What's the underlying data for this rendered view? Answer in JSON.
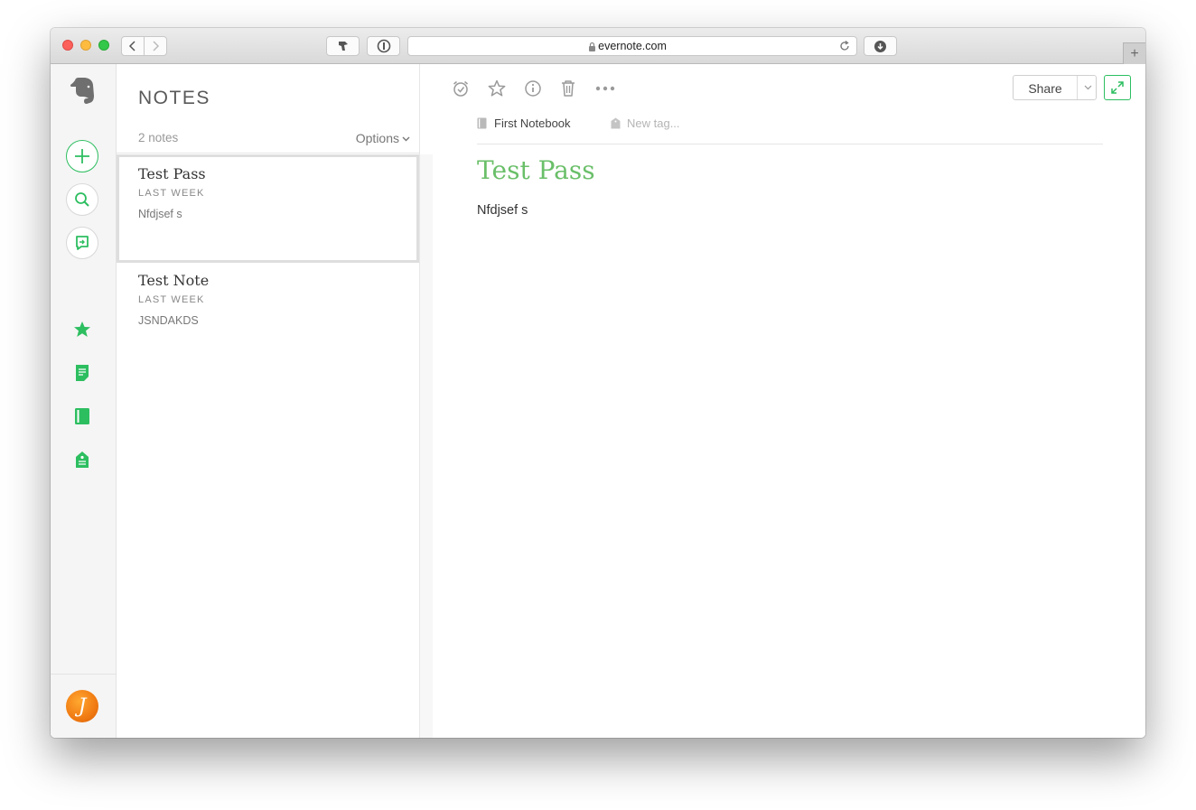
{
  "browser": {
    "url": "evernote.com",
    "new_tab_label": "+"
  },
  "colors": {
    "accent": "#2dbe60",
    "title_green": "#6abf69"
  },
  "sidebar": {
    "icons": [
      "evernote-logo-icon",
      "new-note-icon",
      "search-icon",
      "work-chat-icon",
      "shortcuts-star-icon",
      "notes-icon",
      "notebooks-icon",
      "tags-icon"
    ],
    "avatar_letter": "J"
  },
  "notes_list": {
    "title": "NOTES",
    "count": "2 notes",
    "options_label": "Options",
    "items": [
      {
        "title": "Test Pass",
        "date": "LAST WEEK",
        "snippet": "Nfdjsef s",
        "selected": true
      },
      {
        "title": "Test Note",
        "date": "LAST WEEK",
        "snippet": "JSNDAKDS",
        "selected": false
      }
    ]
  },
  "editor": {
    "toolbar": [
      "reminder-icon",
      "shortcut-star-icon",
      "info-icon",
      "trash-icon",
      "more-icon"
    ],
    "share_label": "Share",
    "notebook": "First Notebook",
    "tag_placeholder": "New tag...",
    "title": "Test Pass",
    "body": "Nfdjsef s"
  }
}
